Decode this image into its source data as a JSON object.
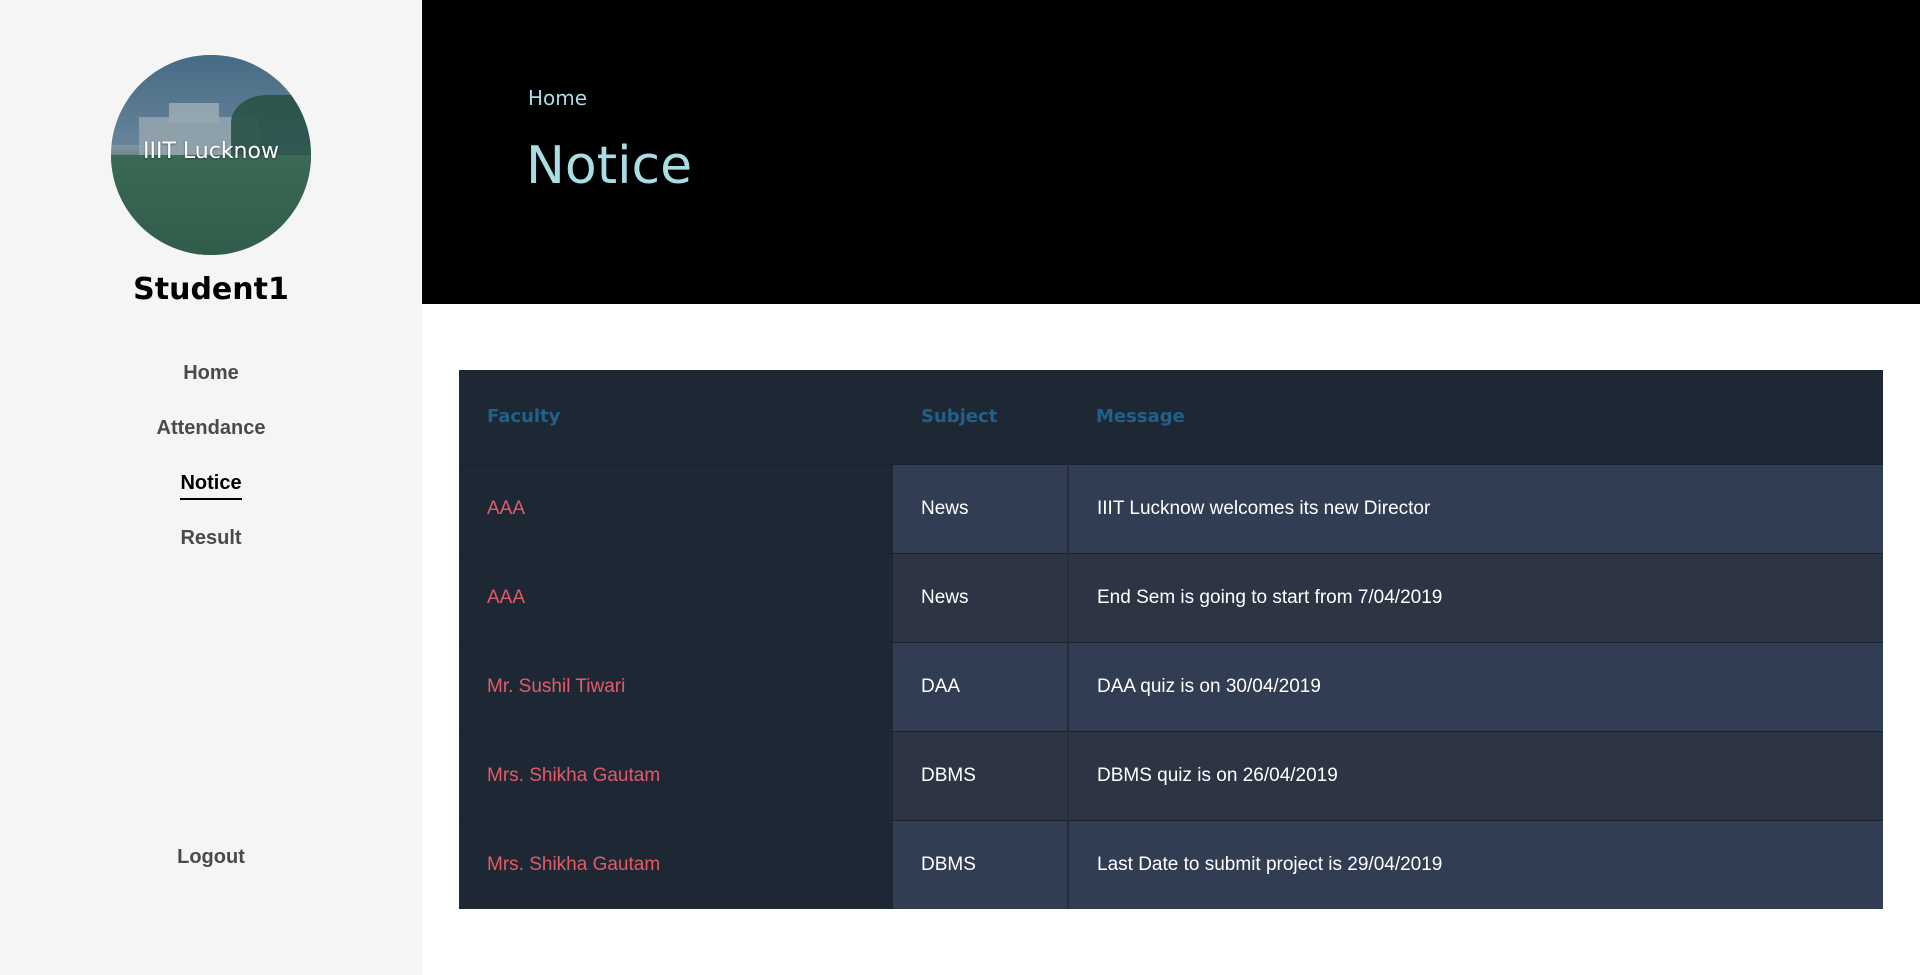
{
  "sidebar": {
    "avatar_label": "IIIT Lucknow",
    "student_name": "Student1",
    "nav": [
      {
        "label": "Home",
        "active": false
      },
      {
        "label": "Attendance",
        "active": false
      },
      {
        "label": "Notice",
        "active": true
      },
      {
        "label": "Result",
        "active": false
      }
    ],
    "logout_label": "Logout"
  },
  "header": {
    "breadcrumb": "Home",
    "title": "Notice"
  },
  "table": {
    "columns": [
      "Faculty",
      "Subject",
      "Message"
    ],
    "rows": [
      {
        "faculty": "AAA",
        "subject": "News",
        "message": "IIIT Lucknow welcomes its new Director"
      },
      {
        "faculty": "AAA",
        "subject": "News",
        "message": "End Sem is going to start from 7/04/2019"
      },
      {
        "faculty": "Mr. Sushil Tiwari",
        "subject": "DAA",
        "message": "DAA quiz is on 30/04/2019"
      },
      {
        "faculty": "Mrs. Shikha Gautam",
        "subject": "DBMS",
        "message": "DBMS quiz is on 26/04/2019"
      },
      {
        "faculty": "Mrs. Shikha Gautam",
        "subject": "DBMS",
        "message": "Last Date to submit project is 29/04/2019"
      }
    ]
  },
  "colors": {
    "accent": "#a8dde4",
    "faculty_text": "#e25b68",
    "header_text": "#20608a",
    "table_dark": "#1e2835"
  }
}
